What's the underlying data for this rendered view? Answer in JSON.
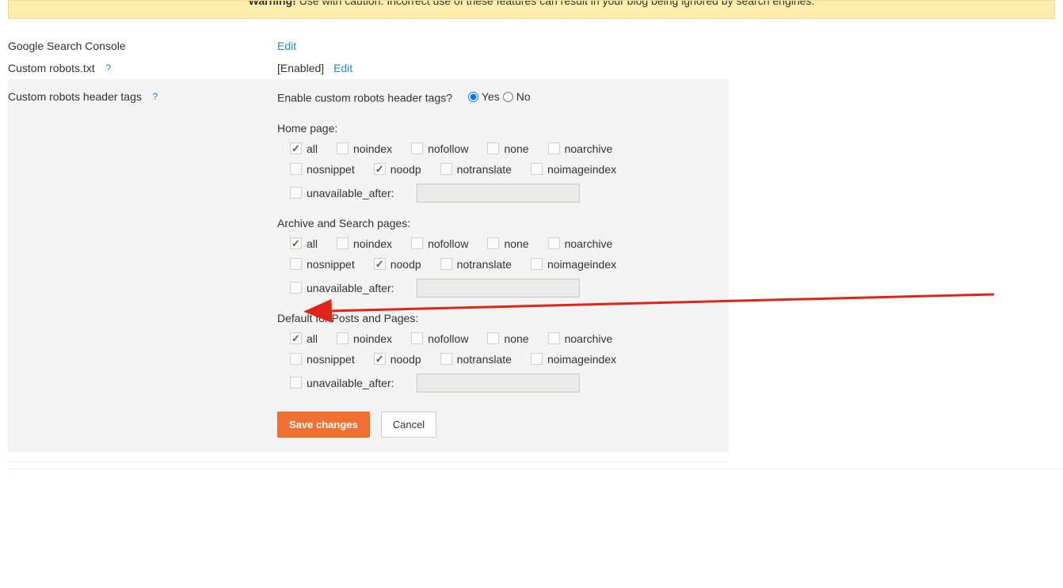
{
  "warning": {
    "prefix": "Warning!",
    "text": " Use with caution. Incorrect use of these features can result in your blog being ignored by search engines."
  },
  "rows": {
    "gsc": {
      "label": "Google Search Console",
      "edit": "Edit"
    },
    "robots": {
      "label": "Custom robots.txt",
      "enabled": "[Enabled]",
      "edit": "Edit"
    },
    "header": {
      "label": "Custom robots header tags",
      "question": "Enable custom robots header tags?",
      "yes": "Yes",
      "no": "No"
    }
  },
  "sections": {
    "home": "Home page:",
    "archive": "Archive and Search pages:",
    "default": "Default for Posts and Pages:"
  },
  "checkboxes": {
    "all": "all",
    "noindex": "noindex",
    "nofollow": "nofollow",
    "none": "none",
    "noarchive": "noarchive",
    "nosnippet": "nosnippet",
    "noodp": "noodp",
    "notranslate": "notranslate",
    "noimageindex": "noimageindex",
    "unavailable_after": "unavailable_after:"
  },
  "buttons": {
    "save": "Save changes",
    "cancel": "Cancel"
  }
}
